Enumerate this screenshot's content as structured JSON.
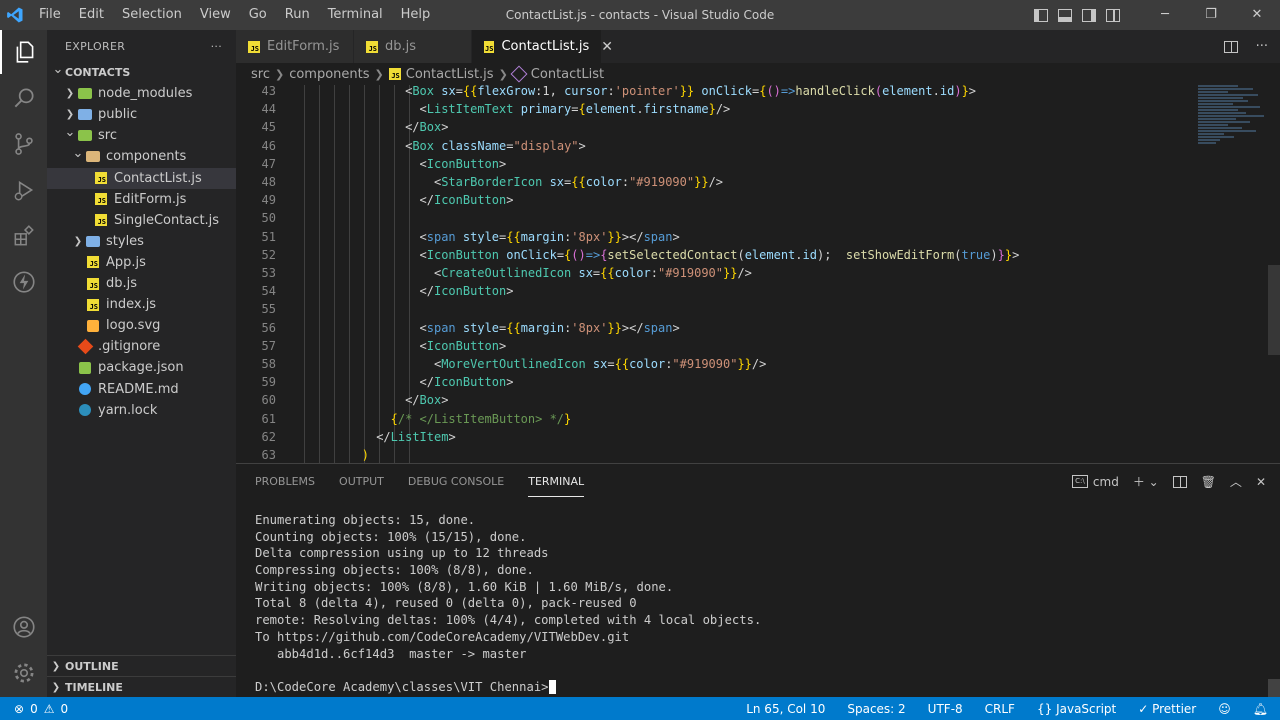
{
  "window": {
    "title": "ContactList.js - contacts - Visual Studio Code",
    "menu": [
      "File",
      "Edit",
      "Selection",
      "View",
      "Go",
      "Run",
      "Terminal",
      "Help"
    ]
  },
  "sidebar": {
    "header": "EXPLORER",
    "more": "···",
    "tree": [
      {
        "label": "CONTACTS",
        "depth": 0,
        "type": "root",
        "chev": "open"
      },
      {
        "label": "node_modules",
        "depth": 1,
        "type": "folder-node",
        "chev": "closed"
      },
      {
        "label": "public",
        "depth": 1,
        "type": "folder-blue",
        "chev": "closed"
      },
      {
        "label": "src",
        "depth": 1,
        "type": "folder-green",
        "chev": "open"
      },
      {
        "label": "components",
        "depth": 2,
        "type": "folder",
        "chev": "open"
      },
      {
        "label": "ContactList.js",
        "depth": 3,
        "type": "js",
        "selected": true
      },
      {
        "label": "EditForm.js",
        "depth": 3,
        "type": "js"
      },
      {
        "label": "SingleContact.js",
        "depth": 3,
        "type": "js"
      },
      {
        "label": "styles",
        "depth": 2,
        "type": "folder-blue",
        "chev": "closed"
      },
      {
        "label": "App.js",
        "depth": 2,
        "type": "js"
      },
      {
        "label": "db.js",
        "depth": 2,
        "type": "js"
      },
      {
        "label": "index.js",
        "depth": 2,
        "type": "js"
      },
      {
        "label": "logo.svg",
        "depth": 2,
        "type": "svg"
      },
      {
        "label": ".gitignore",
        "depth": 1,
        "type": "git"
      },
      {
        "label": "package.json",
        "depth": 1,
        "type": "json"
      },
      {
        "label": "README.md",
        "depth": 1,
        "type": "info"
      },
      {
        "label": "yarn.lock",
        "depth": 1,
        "type": "yarn"
      }
    ],
    "sections": [
      "OUTLINE",
      "TIMELINE"
    ]
  },
  "tabs": [
    {
      "label": "EditForm.js",
      "active": false
    },
    {
      "label": "db.js",
      "active": false
    },
    {
      "label": "ContactList.js",
      "active": true,
      "close": "✕"
    }
  ],
  "breadcrumb": [
    "src",
    "components",
    "ContactList.js",
    "ContactList"
  ],
  "editor": {
    "lines": [
      {
        "n": "43",
        "indent": 16,
        "tokens": [
          [
            "t-pl",
            "<"
          ],
          [
            "t-comp",
            "Box"
          ],
          [
            "t-pl",
            " "
          ],
          [
            "t-attr",
            "sx"
          ],
          [
            "t-pl",
            "="
          ],
          [
            "t-y",
            "{{"
          ],
          [
            "t-attr",
            "flexGrow"
          ],
          [
            "t-pl",
            ":1, "
          ],
          [
            "t-attr",
            "cursor"
          ],
          [
            "t-pl",
            ":"
          ],
          [
            "t-str",
            "'pointer'"
          ],
          [
            "t-y",
            "}}"
          ],
          [
            "t-pl",
            " "
          ],
          [
            "t-attr",
            "onClick"
          ],
          [
            "t-pl",
            "="
          ],
          [
            "t-y",
            "{"
          ],
          [
            "t-br",
            "()"
          ],
          [
            "t-kw",
            "=>"
          ],
          [
            "t-fn",
            "handleClick"
          ],
          [
            "t-br",
            "("
          ],
          [
            "t-attr",
            "element"
          ],
          [
            "t-pl",
            "."
          ],
          [
            "t-attr",
            "id"
          ],
          [
            "t-br",
            ")"
          ],
          [
            "t-y",
            "}"
          ],
          [
            "t-pl",
            ">"
          ]
        ]
      },
      {
        "n": "44",
        "indent": 18,
        "tokens": [
          [
            "t-pl",
            "<"
          ],
          [
            "t-comp",
            "ListItemText"
          ],
          [
            "t-pl",
            " "
          ],
          [
            "t-attr",
            "primary"
          ],
          [
            "t-pl",
            "="
          ],
          [
            "t-y",
            "{"
          ],
          [
            "t-attr",
            "element"
          ],
          [
            "t-pl",
            "."
          ],
          [
            "t-attr",
            "firstname"
          ],
          [
            "t-y",
            "}"
          ],
          [
            "t-pl",
            "/>"
          ]
        ]
      },
      {
        "n": "45",
        "indent": 16,
        "tokens": [
          [
            "t-pl",
            "</"
          ],
          [
            "t-comp",
            "Box"
          ],
          [
            "t-pl",
            ">"
          ]
        ]
      },
      {
        "n": "46",
        "indent": 16,
        "tokens": [
          [
            "t-pl",
            "<"
          ],
          [
            "t-comp",
            "Box"
          ],
          [
            "t-pl",
            " "
          ],
          [
            "t-attr",
            "className"
          ],
          [
            "t-pl",
            "="
          ],
          [
            "t-str",
            "\"display\""
          ],
          [
            "t-pl",
            ">"
          ]
        ]
      },
      {
        "n": "47",
        "indent": 18,
        "tokens": [
          [
            "t-pl",
            "<"
          ],
          [
            "t-comp",
            "IconButton"
          ],
          [
            "t-pl",
            ">"
          ]
        ]
      },
      {
        "n": "48",
        "indent": 20,
        "tokens": [
          [
            "t-pl",
            "<"
          ],
          [
            "t-comp",
            "StarBorderIcon"
          ],
          [
            "t-pl",
            " "
          ],
          [
            "t-attr",
            "sx"
          ],
          [
            "t-pl",
            "="
          ],
          [
            "t-y",
            "{{"
          ],
          [
            "t-attr",
            "color"
          ],
          [
            "t-pl",
            ":"
          ],
          [
            "t-str",
            "\"#919090\""
          ],
          [
            "t-y",
            "}}"
          ],
          [
            "t-pl",
            "/>"
          ]
        ]
      },
      {
        "n": "49",
        "indent": 18,
        "tokens": [
          [
            "t-pl",
            "</"
          ],
          [
            "t-comp",
            "IconButton"
          ],
          [
            "t-pl",
            ">"
          ]
        ]
      },
      {
        "n": "50",
        "indent": 0,
        "tokens": []
      },
      {
        "n": "51",
        "indent": 18,
        "tokens": [
          [
            "t-pl",
            "<"
          ],
          [
            "t-tag",
            "span"
          ],
          [
            "t-pl",
            " "
          ],
          [
            "t-attr",
            "style"
          ],
          [
            "t-pl",
            "="
          ],
          [
            "t-y",
            "{{"
          ],
          [
            "t-attr",
            "margin"
          ],
          [
            "t-pl",
            ":"
          ],
          [
            "t-str",
            "'8px'"
          ],
          [
            "t-y",
            "}}"
          ],
          [
            "t-pl",
            "></"
          ],
          [
            "t-tag",
            "span"
          ],
          [
            "t-pl",
            ">"
          ]
        ]
      },
      {
        "n": "52",
        "indent": 18,
        "tokens": [
          [
            "t-pl",
            "<"
          ],
          [
            "t-comp",
            "IconButton"
          ],
          [
            "t-pl",
            " "
          ],
          [
            "t-attr",
            "onClick"
          ],
          [
            "t-pl",
            "="
          ],
          [
            "t-y",
            "{"
          ],
          [
            "t-br",
            "()"
          ],
          [
            "t-kw",
            "=>"
          ],
          [
            "t-br",
            "{"
          ],
          [
            "t-fn",
            "setSelectedContact"
          ],
          [
            "t-pl",
            "("
          ],
          [
            "t-attr",
            "element"
          ],
          [
            "t-pl",
            "."
          ],
          [
            "t-attr",
            "id"
          ],
          [
            "t-pl",
            ");  "
          ],
          [
            "t-fn",
            "setShowEditForm"
          ],
          [
            "t-pl",
            "("
          ],
          [
            "t-kw",
            "true"
          ],
          [
            "t-pl",
            ")"
          ],
          [
            "t-br",
            "}"
          ],
          [
            "t-y",
            "}"
          ],
          [
            "t-pl",
            ">"
          ]
        ]
      },
      {
        "n": "53",
        "indent": 20,
        "tokens": [
          [
            "t-pl",
            "<"
          ],
          [
            "t-comp",
            "CreateOutlinedIcon"
          ],
          [
            "t-pl",
            " "
          ],
          [
            "t-attr",
            "sx"
          ],
          [
            "t-pl",
            "="
          ],
          [
            "t-y",
            "{{"
          ],
          [
            "t-attr",
            "color"
          ],
          [
            "t-pl",
            ":"
          ],
          [
            "t-str",
            "\"#919090\""
          ],
          [
            "t-y",
            "}}"
          ],
          [
            "t-pl",
            "/>"
          ]
        ]
      },
      {
        "n": "54",
        "indent": 18,
        "tokens": [
          [
            "t-pl",
            "</"
          ],
          [
            "t-comp",
            "IconButton"
          ],
          [
            "t-pl",
            ">"
          ]
        ]
      },
      {
        "n": "55",
        "indent": 0,
        "tokens": []
      },
      {
        "n": "56",
        "indent": 18,
        "tokens": [
          [
            "t-pl",
            "<"
          ],
          [
            "t-tag",
            "span"
          ],
          [
            "t-pl",
            " "
          ],
          [
            "t-attr",
            "style"
          ],
          [
            "t-pl",
            "="
          ],
          [
            "t-y",
            "{{"
          ],
          [
            "t-attr",
            "margin"
          ],
          [
            "t-pl",
            ":"
          ],
          [
            "t-str",
            "'8px'"
          ],
          [
            "t-y",
            "}}"
          ],
          [
            "t-pl",
            "></"
          ],
          [
            "t-tag",
            "span"
          ],
          [
            "t-pl",
            ">"
          ]
        ]
      },
      {
        "n": "57",
        "indent": 18,
        "tokens": [
          [
            "t-pl",
            "<"
          ],
          [
            "t-comp",
            "IconButton"
          ],
          [
            "t-pl",
            ">"
          ]
        ]
      },
      {
        "n": "58",
        "indent": 20,
        "tokens": [
          [
            "t-pl",
            "<"
          ],
          [
            "t-comp",
            "MoreVertOutlinedIcon"
          ],
          [
            "t-pl",
            " "
          ],
          [
            "t-attr",
            "sx"
          ],
          [
            "t-pl",
            "="
          ],
          [
            "t-y",
            "{{"
          ],
          [
            "t-attr",
            "color"
          ],
          [
            "t-pl",
            ":"
          ],
          [
            "t-str",
            "\"#919090\""
          ],
          [
            "t-y",
            "}}"
          ],
          [
            "t-pl",
            "/>"
          ]
        ]
      },
      {
        "n": "59",
        "indent": 18,
        "tokens": [
          [
            "t-pl",
            "</"
          ],
          [
            "t-comp",
            "IconButton"
          ],
          [
            "t-pl",
            ">"
          ]
        ]
      },
      {
        "n": "60",
        "indent": 16,
        "tokens": [
          [
            "t-pl",
            "</"
          ],
          [
            "t-comp",
            "Box"
          ],
          [
            "t-pl",
            ">"
          ]
        ]
      },
      {
        "n": "61",
        "indent": 14,
        "tokens": [
          [
            "t-y",
            "{"
          ],
          [
            "t-cm",
            "/* </ListItemButton> */"
          ],
          [
            "t-y",
            "}"
          ]
        ]
      },
      {
        "n": "62",
        "indent": 12,
        "tokens": [
          [
            "t-pl",
            "</"
          ],
          [
            "t-comp",
            "ListItem"
          ],
          [
            "t-pl",
            ">"
          ]
        ]
      },
      {
        "n": "63",
        "indent": 10,
        "tokens": [
          [
            "t-y",
            ")"
          ]
        ]
      }
    ]
  },
  "panel": {
    "tabs": [
      "PROBLEMS",
      "OUTPUT",
      "DEBUG CONSOLE",
      "TERMINAL"
    ],
    "active_tab": "TERMINAL",
    "shell": "cmd",
    "terminal_lines": [
      "Enumerating objects: 15, done.",
      "Counting objects: 100% (15/15), done.",
      "Delta compression using up to 12 threads",
      "Compressing objects: 100% (8/8), done.",
      "Writing objects: 100% (8/8), 1.60 KiB | 1.60 MiB/s, done.",
      "Total 8 (delta 4), reused 0 (delta 0), pack-reused 0",
      "remote: Resolving deltas: 100% (4/4), completed with 4 local objects.",
      "To https://github.com/CodeCoreAcademy/VITWebDev.git",
      "   abb4d1d..6cf14d3  master -> master",
      "",
      "D:\\CodeCore Academy\\classes\\VIT Chennai>"
    ]
  },
  "statusbar": {
    "errors": "0",
    "warnings": "0",
    "position": "Ln 65, Col 10",
    "spaces": "Spaces: 2",
    "encoding": "UTF-8",
    "eol": "CRLF",
    "language": "JavaScript",
    "prettier": "✓ Prettier"
  },
  "colors": {
    "accent": "#007acc",
    "title_bar": "#3c3c3c",
    "sidebar": "#252526",
    "editor": "#1e1e1e"
  }
}
